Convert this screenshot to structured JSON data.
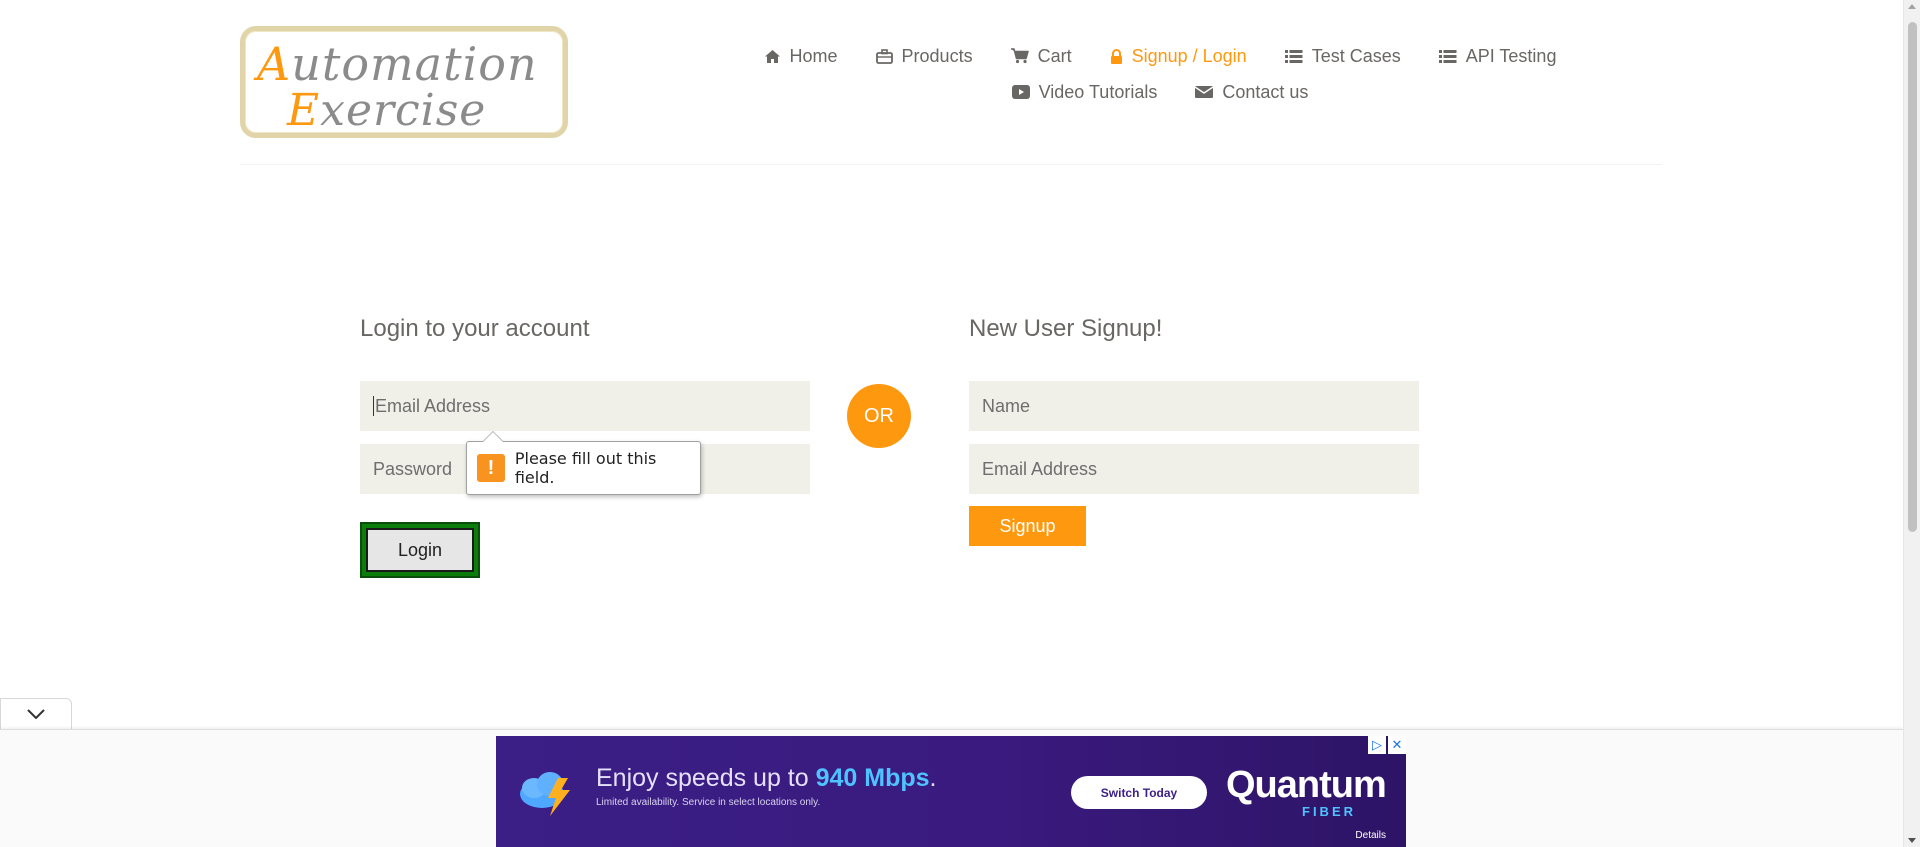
{
  "logo": {
    "line1_cap": "A",
    "line1_rest": "utomation",
    "line2_cap": "E",
    "line2_rest": "xercise"
  },
  "nav": {
    "row1": [
      {
        "icon": "home-icon",
        "label": "Home",
        "active": false
      },
      {
        "icon": "briefcase-icon",
        "label": "Products",
        "active": false
      },
      {
        "icon": "cart-icon",
        "label": "Cart",
        "active": false
      },
      {
        "icon": "lock-icon",
        "label": "Signup / Login",
        "active": true
      },
      {
        "icon": "list-icon",
        "label": "Test Cases",
        "active": false
      },
      {
        "icon": "list-icon",
        "label": "API Testing",
        "active": false
      }
    ],
    "row2": [
      {
        "icon": "youtube-icon",
        "label": "Video Tutorials",
        "active": false
      },
      {
        "icon": "envelope-icon",
        "label": "Contact us",
        "active": false
      }
    ]
  },
  "login": {
    "title": "Login to your account",
    "email_placeholder": "Email Address",
    "password_placeholder": "Password",
    "button": "Login",
    "tooltip": "Please fill out this field."
  },
  "or_label": "OR",
  "signup": {
    "title": "New User Signup!",
    "name_placeholder": "Name",
    "email_placeholder": "Email Address",
    "button": "Signup"
  },
  "ad": {
    "headline_pre": "Enjoy speeds up to ",
    "headline_highlight": "940 Mbps",
    "headline_post": ".",
    "subline": "Limited availability. Service in select locations only.",
    "cta": "Switch Today",
    "brand": "Quantum",
    "brand_sub": "FIBER",
    "details": "Details"
  },
  "colors": {
    "accent": "#fe980f",
    "field_bg": "#f0f0e9",
    "text": "#696763",
    "ad_bg": "#3b1f86"
  }
}
